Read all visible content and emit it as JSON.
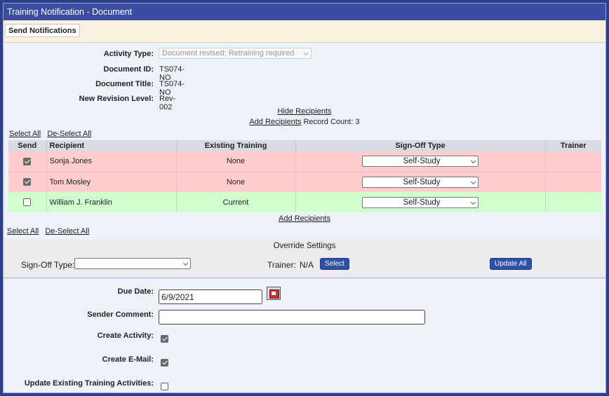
{
  "window": {
    "title": "Training Notification - Document"
  },
  "tabs": {
    "send_notifications": "Send Notifications"
  },
  "form": {
    "activity_type_label": "Activity Type:",
    "activity_type_value": "Document revised; Retraining required",
    "document_id_label": "Document ID:",
    "document_id_value": "TS074-NO",
    "document_title_label": "Document Title:",
    "document_title_value": "TS074-NO",
    "new_revision_label": "New Revision Level:",
    "new_revision_value": "Rev-002"
  },
  "recipients": {
    "hide_link": "Hide Recipients",
    "add_link": "Add Recipients",
    "record_count": "Record Count: 3",
    "select_all": "Select All",
    "deselect_all": "De-Select All",
    "headers": [
      "Send",
      "Recipient",
      "Existing Training",
      "Sign-Off Type",
      "Trainer"
    ],
    "rows": [
      {
        "send": true,
        "recipient": "Sonja Jones",
        "existing_training": "None",
        "signoff": "Self-Study",
        "trainer": "",
        "status": "red"
      },
      {
        "send": true,
        "recipient": "Tom Mosley",
        "existing_training": "None",
        "signoff": "Self-Study",
        "trainer": "",
        "status": "red"
      },
      {
        "send": false,
        "recipient": "William J. Franklin",
        "existing_training": "Current",
        "signoff": "Self-Study",
        "trainer": "",
        "status": "green"
      }
    ],
    "add_link_bottom": "Add Recipients",
    "select_all_bottom": "Select All",
    "deselect_all_bottom": "De-Select All"
  },
  "override": {
    "title": "Override Settings",
    "signoff_label": "Sign-Off Type:",
    "signoff_value": "",
    "trainer_label": "Trainer:",
    "trainer_value": "N/A",
    "select_button": "Select",
    "update_all_button": "Update All"
  },
  "notification": {
    "due_date_label": "Due Date:",
    "due_date_value": "6/9/2021",
    "sender_comment_label": "Sender Comment:",
    "sender_comment_value": "",
    "create_activity_label": "Create Activity:",
    "create_activity_checked": true,
    "create_email_label": "Create E-Mail:",
    "create_email_checked": true,
    "update_existing_label": "Update Existing Training Activities:",
    "update_existing_checked": false
  },
  "colors": {
    "titlebar": "#3a4da3",
    "row_red": "#ffcdcd",
    "row_green": "#cfffcf",
    "button": "#2f4fa8"
  },
  "icons": {
    "calendar": "calendar-icon",
    "dropdown": "chevron-down-icon"
  }
}
